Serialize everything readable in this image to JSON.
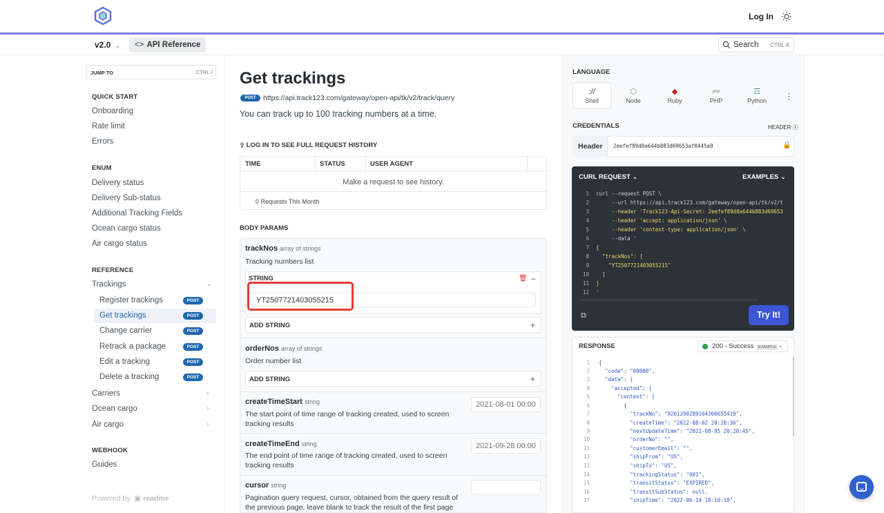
{
  "header": {
    "login": "Log In"
  },
  "subbar": {
    "version": "v2.0",
    "api_reference": "API Reference",
    "search": "Search",
    "search_shortcut": "CTRL-K"
  },
  "sidebar": {
    "jump_to": "JUMP TO",
    "jump_shortcut": "CTRL-/",
    "quick_start": {
      "title": "QUICK START",
      "items": [
        "Onboarding",
        "Rate limit",
        "Errors"
      ]
    },
    "enum": {
      "title": "ENUM",
      "items": [
        "Delivery status",
        "Delivery Sub-status",
        "Additional Tracking Fields",
        "Ocean cargo status",
        "Air cargo status"
      ]
    },
    "reference": {
      "title": "REFERENCE",
      "trackings": "Trackings",
      "sub_items": [
        "Register trackings",
        "Get trackings",
        "Change carrier",
        "Retrack a package",
        "Edit a tracking",
        "Delete a tracking"
      ],
      "badge": "POST",
      "others": [
        "Carriers",
        "Ocean cargo",
        "Air cargo"
      ]
    },
    "webhook": {
      "title": "WEBHOOK",
      "items": [
        "Guides"
      ]
    },
    "powered_by": "Powered by",
    "readme": "readme"
  },
  "main": {
    "title": "Get trackings",
    "method": "POST",
    "url": "https://api.track123.com/gateway/open-api/tk/v2/track/query",
    "description": "You can track up to 100 tracking numbers at a time.",
    "history_title": "LOG IN TO SEE FULL REQUEST HISTORY",
    "history_cols": [
      "TIME",
      "STATUS",
      "USER AGENT"
    ],
    "history_empty": "Make a request to see history.",
    "history_count": "0 Requests This Month",
    "body_params": "BODY PARAMS",
    "params": [
      {
        "name": "trackNos",
        "type": "array of strings",
        "desc": "Tracking numbers list"
      },
      {
        "name": "orderNos",
        "type": "array of strings",
        "desc": "Order number list"
      },
      {
        "name": "createTimeStart",
        "type": "string",
        "desc": "The start point of time range of tracking created, used to screen tracking results",
        "value": "2021-08-01 00:00"
      },
      {
        "name": "createTimeEnd",
        "type": "string",
        "desc": "The end point of time range of tracking created, used to screen tracking results",
        "value": "2021-09-28 00:00"
      },
      {
        "name": "cursor",
        "type": "string",
        "desc": "Pagination query request, cursor, obtained from the query result of the previous page, leave blank to track the result of the first page"
      }
    ],
    "string_label": "STRING",
    "string_value": "YT2507721403055215",
    "add_string": "ADD STRING"
  },
  "right": {
    "language_label": "LANGUAGE",
    "languages": [
      "Shell",
      "Node",
      "Ruby",
      "PHP",
      "Python"
    ],
    "credentials_label": "CREDENTIALS",
    "header_hint": "HEADER",
    "header_label": "Header",
    "header_value": "2eefef89d8a644b883d69653af0445a9",
    "curl_label": "CURL REQUEST",
    "examples_label": "EXAMPLES",
    "code_lines": [
      {
        "n": "1",
        "t": "curl --request POST \\"
      },
      {
        "n": "2",
        "t": "     --url https://api.track123.com/gateway/open-api/tk/v2/t"
      },
      {
        "n": "3",
        "t": "     --header 'Track123-Api-Secret: 2eefef89d8a644b883d69653"
      },
      {
        "n": "4",
        "t": "     --header 'accept: application/json' \\"
      },
      {
        "n": "5",
        "t": "     --header 'content-type: application/json' \\"
      },
      {
        "n": "6",
        "t": "     --data '"
      },
      {
        "n": "7",
        "t": "{"
      },
      {
        "n": "8",
        "t": "  \"trackNos\": ["
      },
      {
        "n": "9",
        "t": "    \"YT2507721403055215\""
      },
      {
        "n": "10",
        "t": "  ]"
      },
      {
        "n": "11",
        "t": "}"
      },
      {
        "n": "12",
        "t": "'"
      }
    ],
    "try_it": "Try It!",
    "response_label": "RESPONSE",
    "status": "200 - Success",
    "example_tag": "EXAMPLE",
    "response_lines": [
      {
        "n": "1",
        "t": "{"
      },
      {
        "n": "2",
        "t": "  \"code\": \"00000\","
      },
      {
        "n": "3",
        "t": "  \"data\": {"
      },
      {
        "n": "4",
        "t": "    \"accepted\": {"
      },
      {
        "n": "5",
        "t": "      \"content\": ["
      },
      {
        "n": "6",
        "t": "        {"
      },
      {
        "n": "7",
        "t": "          \"trackNo\": \"9261290289104300655419\","
      },
      {
        "n": "8",
        "t": "          \"createTime\": \"2022-08-02 20:20:36\","
      },
      {
        "n": "9",
        "t": "          \"nextUpdateTime\": \"2022-08-05 20:20:45\","
      },
      {
        "n": "10",
        "t": "          \"orderNo\": \"\","
      },
      {
        "n": "11",
        "t": "          \"customerEmail\": \"\","
      },
      {
        "n": "12",
        "t": "          \"shipFrom\": \"US\","
      },
      {
        "n": "13",
        "t": "          \"shipTo\": \"US\","
      },
      {
        "n": "14",
        "t": "          \"trackingStatus\": \"001\","
      },
      {
        "n": "15",
        "t": "          \"transitStatus\": \"EXPIRED\","
      },
      {
        "n": "16",
        "t": "          \"transitSubStatus\": null,"
      },
      {
        "n": "17",
        "t": "          \"shipTime\": \"2022-06-14 18:10:10\","
      }
    ]
  },
  "colors": {
    "accent": "#3b55d4",
    "topline": "#7b7ee8",
    "post_badge": "#1f67b0",
    "highlight": "#e53935"
  }
}
